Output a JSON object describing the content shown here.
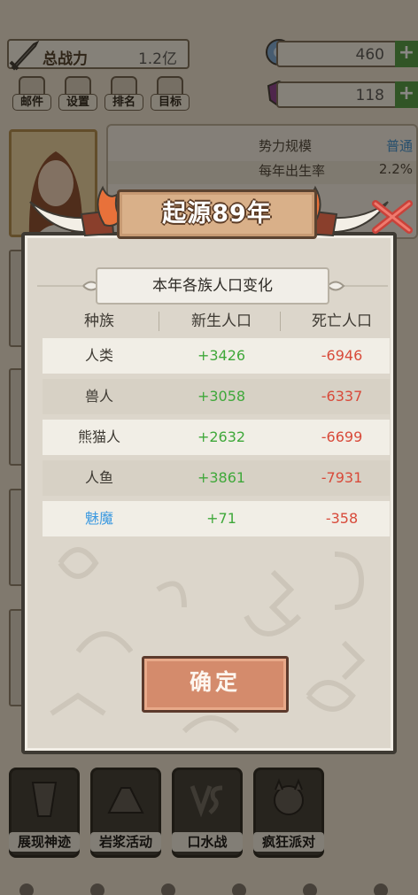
{
  "hud": {
    "power_label": "总战力",
    "power_value": "1.2亿",
    "resource1_value": "460",
    "resource2_value": "118",
    "plus_symbol": "+"
  },
  "menu": [
    {
      "label": "邮件"
    },
    {
      "label": "设置"
    },
    {
      "label": "排名"
    },
    {
      "label": "目标"
    }
  ],
  "info_panel": {
    "rows": [
      {
        "key": "势力规模",
        "value": "普通"
      },
      {
        "key": "每年出生率",
        "value": "2.2%"
      }
    ]
  },
  "dialog": {
    "title": "起源89年",
    "subtitle": "本年各族人口变化",
    "columns": [
      "种族",
      "新生人口",
      "死亡人口"
    ],
    "rows": [
      {
        "race": "人类",
        "born": "+3426",
        "died": "-6946"
      },
      {
        "race": "兽人",
        "born": "+3058",
        "died": "-6337"
      },
      {
        "race": "熊猫人",
        "born": "+2632",
        "died": "-6699"
      },
      {
        "race": "人鱼",
        "born": "+3861",
        "died": "-7931"
      },
      {
        "race": "魅魔",
        "born": "+71",
        "died": "-358"
      }
    ],
    "confirm_label": "确定"
  },
  "actions": [
    {
      "label": "展现神迹"
    },
    {
      "label": "岩浆活动"
    },
    {
      "label": "口水战"
    },
    {
      "label": "疯狂派对"
    }
  ],
  "colors": {
    "positive": "#3fa83a",
    "negative": "#d84a3a",
    "special_race": "#3d9ae0"
  }
}
